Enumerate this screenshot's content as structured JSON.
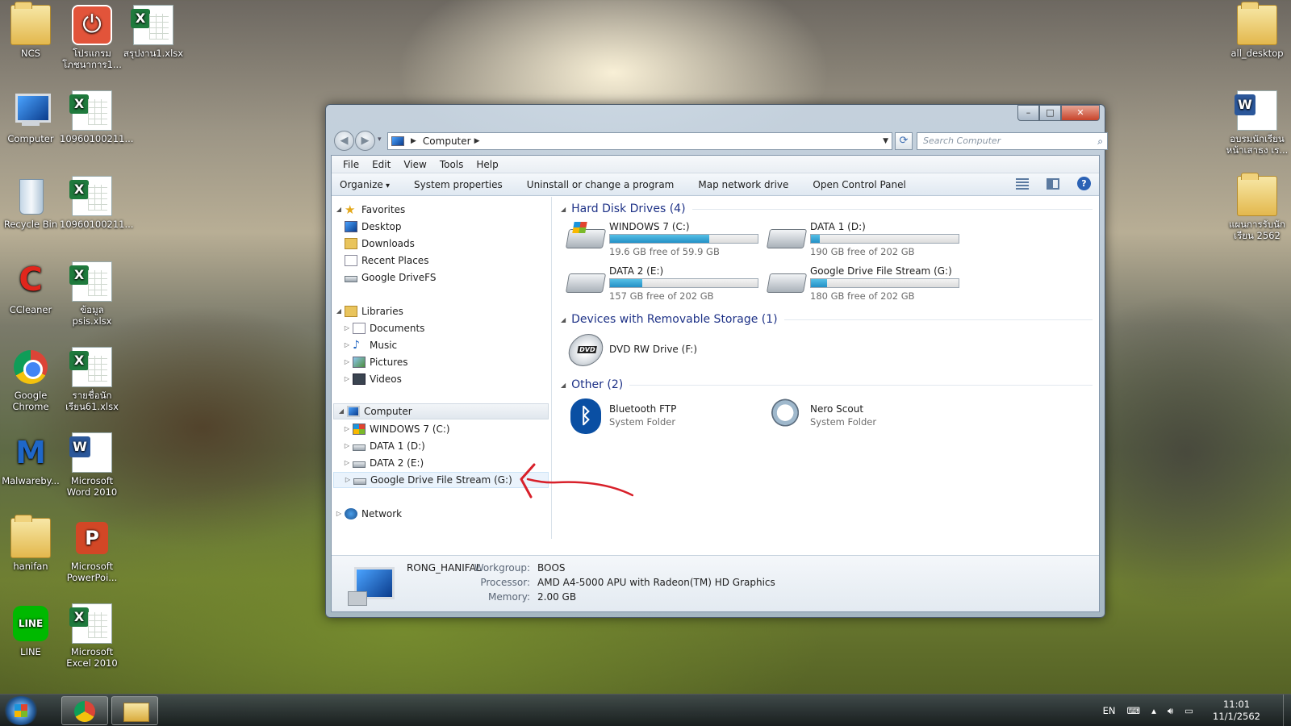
{
  "desktop": {
    "icons": [
      {
        "label": "NCS"
      },
      {
        "label": "โปรแกรม โภชนาการ1..."
      },
      {
        "label": "สรุปงาน1.xlsx"
      },
      {
        "label": "Computer"
      },
      {
        "label": "10960100211..."
      },
      {
        "label": "Recycle Bin"
      },
      {
        "label": "10960100211..."
      },
      {
        "label": "CCleaner"
      },
      {
        "label": "ข้อมูล psis.xlsx"
      },
      {
        "label": "Google Chrome"
      },
      {
        "label": "รายชื่อนัก เรียน61.xlsx"
      },
      {
        "label": "Malwareby..."
      },
      {
        "label": "Microsoft Word 2010"
      },
      {
        "label": "hanifan"
      },
      {
        "label": "Microsoft PowerPoi..."
      },
      {
        "label": "LINE"
      },
      {
        "label": "Microsoft Excel 2010"
      },
      {
        "label": "all_desktop"
      },
      {
        "label": "อบรมนักเรียน หน้าเสาธง เร..."
      },
      {
        "label": "แผนการรับนัก เรียน 2562"
      }
    ]
  },
  "window": {
    "controls": {
      "minimize": "–",
      "maximize": "□",
      "close": "✕"
    },
    "address": {
      "location": "Computer"
    },
    "search": {
      "placeholder": "Search Computer"
    },
    "menu": [
      "File",
      "Edit",
      "View",
      "Tools",
      "Help"
    ],
    "commands": [
      "Organize",
      "System properties",
      "Uninstall or change a program",
      "Map network drive",
      "Open Control Panel"
    ],
    "nav": {
      "favorites": {
        "label": "Favorites",
        "items": [
          "Desktop",
          "Downloads",
          "Recent Places",
          "Google DriveFS"
        ]
      },
      "libraries": {
        "label": "Libraries",
        "items": [
          "Documents",
          "Music",
          "Pictures",
          "Videos"
        ]
      },
      "computer": {
        "label": "Computer",
        "items": [
          "WINDOWS 7 (C:)",
          "DATA 1 (D:)",
          "DATA 2 (E:)",
          "Google Drive File Stream (G:)"
        ]
      },
      "network": {
        "label": "Network"
      }
    },
    "groups": {
      "hdd": "Hard Disk Drives (4)",
      "removable": "Devices with Removable Storage (1)",
      "other": "Other (2)"
    },
    "drives": [
      {
        "name": "WINDOWS 7 (C:)",
        "free": "19.6 GB free of 59.9 GB",
        "used_fraction": 0.67
      },
      {
        "name": "DATA 1 (D:)",
        "free": "190 GB free of 202 GB",
        "used_fraction": 0.06
      },
      {
        "name": "DATA 2 (E:)",
        "free": "157 GB free of 202 GB",
        "used_fraction": 0.22
      },
      {
        "name": "Google Drive File Stream (G:)",
        "free": "180 GB free of 202 GB",
        "used_fraction": 0.11
      }
    ],
    "removable": [
      {
        "name": "DVD RW Drive (F:)"
      }
    ],
    "other": [
      {
        "name": "Bluetooth FTP",
        "type": "System Folder"
      },
      {
        "name": "Nero Scout",
        "type": "System Folder"
      }
    ],
    "details": {
      "computer_name": "RONG_HANIFAL",
      "workgroup_label": "Workgroup:",
      "workgroup": "BOOS",
      "processor_label": "Processor:",
      "processor": "AMD A4-5000 APU with Radeon(TM) HD Graphics",
      "memory_label": "Memory:",
      "memory": "2.00 GB"
    }
  },
  "taskbar": {
    "language": "EN",
    "time": "11:01",
    "date": "11/1/2562"
  },
  "colors": {
    "group_header": "#1e3287",
    "progress_fill": "#2390c6",
    "annotation": "#d8202a"
  }
}
